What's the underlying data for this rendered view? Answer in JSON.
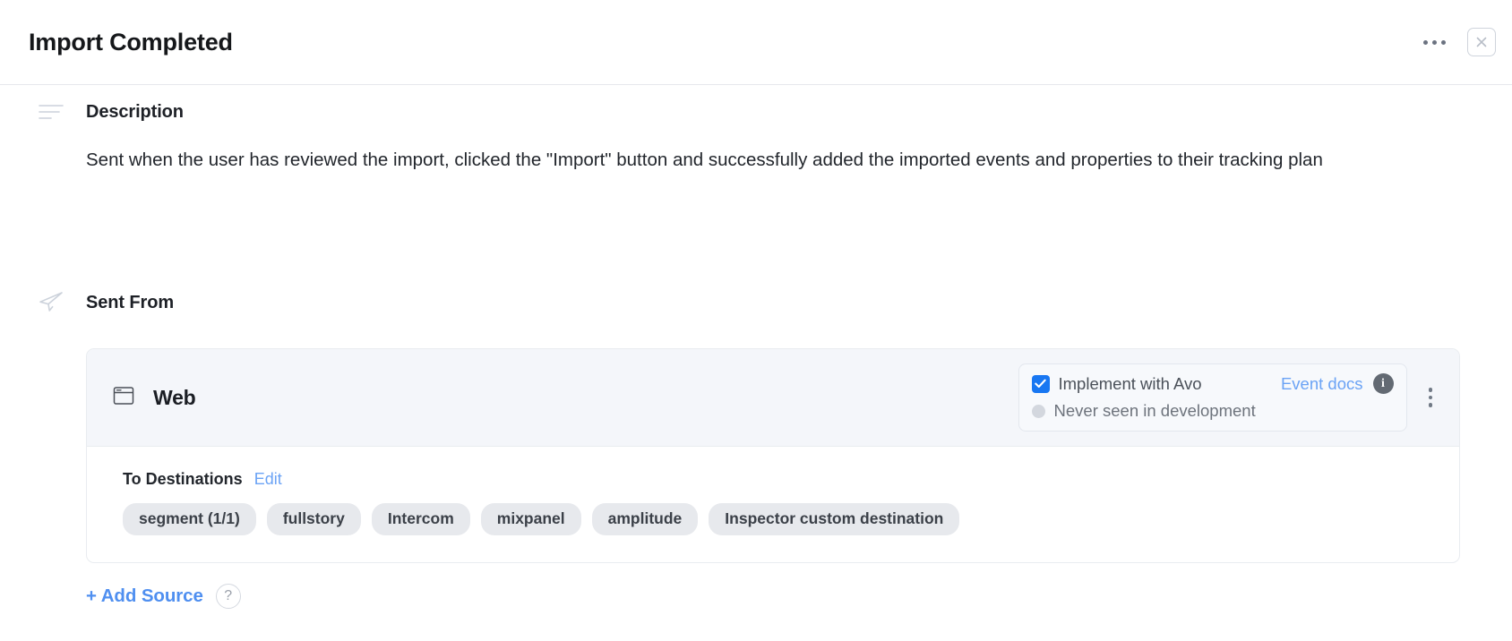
{
  "header": {
    "title": "Import Completed",
    "more_menu": "•••",
    "close_label": "×"
  },
  "description": {
    "section_title": "Description",
    "icon": "lines-icon",
    "text": "Sent when the user has reviewed the import, clicked the \"Import\" button and successfully added the imported events and properties to their tracking plan"
  },
  "sent_from": {
    "section_title": "Sent From",
    "icon": "paper-plane-icon",
    "source": {
      "name": "Web",
      "icon": "browser-window-icon",
      "implement": {
        "checkbox_checked": true,
        "label": "Implement with Avo",
        "docs_link": "Event docs",
        "info_glyph": "i",
        "status": "Never seen in development",
        "status_color": "#d3d7de"
      },
      "destinations": {
        "title": "To Destinations",
        "edit_label": "Edit",
        "items": [
          "segment (1/1)",
          "fullstory",
          "Intercom",
          "mixpanel",
          "amplitude",
          "Inspector custom destination"
        ]
      }
    },
    "add_source_label": "+ Add Source",
    "help_glyph": "?"
  },
  "colors": {
    "accent_blue": "#4f8ff0",
    "link_blue": "#6ba3f5",
    "checkbox_blue": "#1877f2",
    "card_header_bg": "#f4f6fa",
    "pill_bg": "#e7e9ed"
  }
}
